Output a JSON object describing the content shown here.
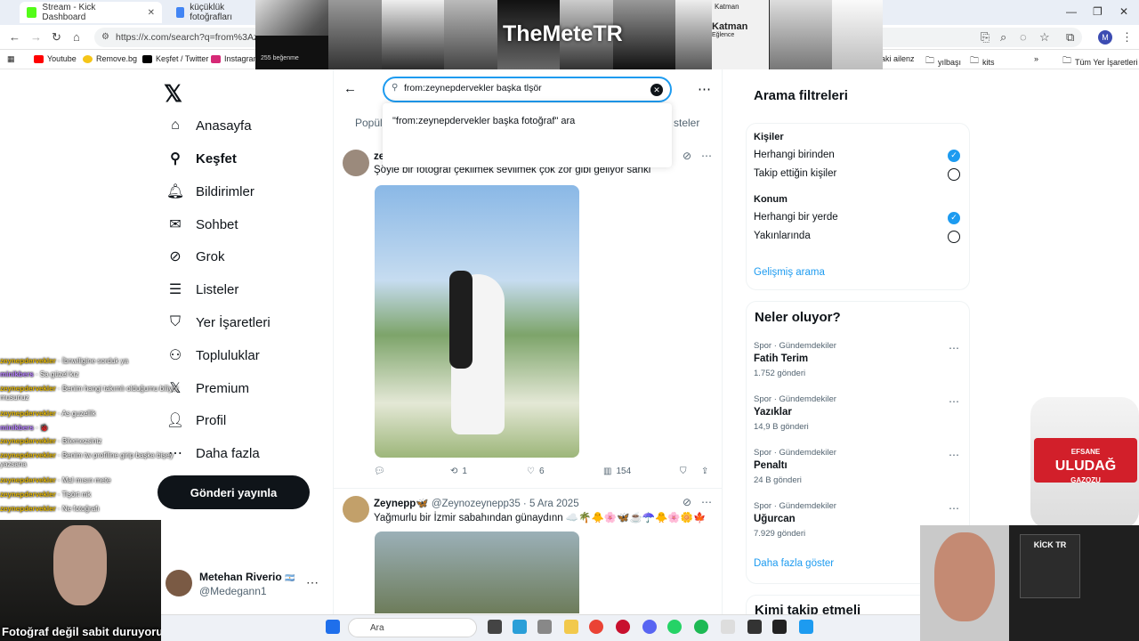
{
  "browser": {
    "tabs": [
      {
        "title": "Stream - Kick Dashboard",
        "color": "#53fc18"
      },
      {
        "title": "küçüklük fotoğrafları",
        "color": "#4285f4"
      }
    ],
    "url": "https://x.com/search?q=from%3Azeyn",
    "bookmarks": [
      "Youtube",
      "Remove.bg",
      "Keşfet / Twitter",
      "Instagram",
      "aki ailenz",
      "yılbaşı",
      "kits"
    ],
    "other_bookmarks": "Tüm Yer İşaretleri",
    "profile_initial": "M"
  },
  "overlay": {
    "brand": "TheMeteTR",
    "ig_text": "255 beğenme",
    "katman_label": "Katman",
    "katman_sub": "Eğlence"
  },
  "nav": {
    "items": [
      {
        "label": "Anasayfa",
        "icon": "home-icon"
      },
      {
        "label": "Keşfet",
        "icon": "search-icon"
      },
      {
        "label": "Bildirimler",
        "icon": "bell-icon"
      },
      {
        "label": "Sohbet",
        "icon": "mail-icon"
      },
      {
        "label": "Grok",
        "icon": "grok-icon"
      },
      {
        "label": "Listeler",
        "icon": "list-icon"
      },
      {
        "label": "Yer İşaretleri",
        "icon": "bookmark-icon"
      },
      {
        "label": "Topluluklar",
        "icon": "community-icon"
      },
      {
        "label": "Premium",
        "icon": "x-icon"
      },
      {
        "label": "Profil",
        "icon": "profile-icon"
      },
      {
        "label": "Daha fazla",
        "icon": "more-icon"
      }
    ],
    "post_button": "Gönderi yayınla",
    "account_name": "Metehan Riverio",
    "account_handle": "@Medegann1"
  },
  "search": {
    "query": "from:zeynepdervekler başka tlşör",
    "suggestion": "\"from:zeynepdervekler başka fotoğraf\" ara",
    "tab_left": "Popül",
    "tab_right": "steler"
  },
  "tweets": [
    {
      "author_short": "ze",
      "text": "Şöyle bir fotoğraf çekilmek sevilmek çok zor gibi geliyor sanki",
      "retweets": "1",
      "likes": "6",
      "views": "154"
    },
    {
      "author": "Zeynepp🦋",
      "handle": "@Zeynozeynepp35",
      "date": "5 Ara 2025",
      "text": "Yağmurlu bir İzmir sabahından günaydınn ☁️🌴🐥🌸🦋☕☂️🐥🌸🌼🍁"
    }
  ],
  "filters": {
    "title": "Arama filtreleri",
    "people_label": "Kişiler",
    "people_options": [
      "Herhangi birinden",
      "Takip ettiğin kişiler"
    ],
    "location_label": "Konum",
    "location_options": [
      "Herhangi bir yerde",
      "Yakınlarında"
    ],
    "advanced": "Gelişmiş arama"
  },
  "trends": {
    "title": "Neler oluyor?",
    "items": [
      {
        "category": "Spor · Gündemdekiler",
        "name": "Fatih Terim",
        "count": "1.752 gönderi"
      },
      {
        "category": "Spor · Gündemdekiler",
        "name": "Yazıklar",
        "count": "14,9 B gönderi"
      },
      {
        "category": "Spor · Gündemdekiler",
        "name": "Penaltı",
        "count": "24 B gönderi"
      },
      {
        "category": "Spor · Gündemdekiler",
        "name": "Uğurcan",
        "count": "7.929 gönderi"
      }
    ],
    "show_more": "Daha fazla göster",
    "who_to_follow": "Kimi takip etmeli"
  },
  "chat": [
    {
      "user": "zeynepdervekler",
      "msg": "İbnwiligine sorduk ya"
    },
    {
      "user": "minikbers",
      "msg": "Sa güzel kız"
    },
    {
      "user": "zeynepdervekler",
      "msg": "Benim hangi takımlı olduğumu biliyor musunuz"
    },
    {
      "user": "zeynepdervekler",
      "msg": "As guzellik"
    },
    {
      "user": "minikbers",
      "msg": "🐞"
    },
    {
      "user": "zeynepdervekler",
      "msg": "Bilemezsiniz"
    },
    {
      "user": "zeynepdervekler",
      "msg": "Benim tw profiline girip başka bişey yazsana"
    },
    {
      "user": "zeynepdervekler",
      "msg": "Mal mısın mete"
    },
    {
      "user": "zeynepdervekler",
      "msg": "Tişört mk"
    },
    {
      "user": "zeynepdervekler",
      "msg": "Ne fotoğrafı"
    }
  ],
  "stream": {
    "caption": "Fotoğraf değil sabit duruyorum",
    "kick_title": "KİCK TR",
    "bottle_brand": "ULUDAĞ",
    "bottle_top": "EFSANE",
    "bottle_sub": "GAZOZU"
  },
  "taskbar": {
    "search_placeholder": "Ara"
  }
}
